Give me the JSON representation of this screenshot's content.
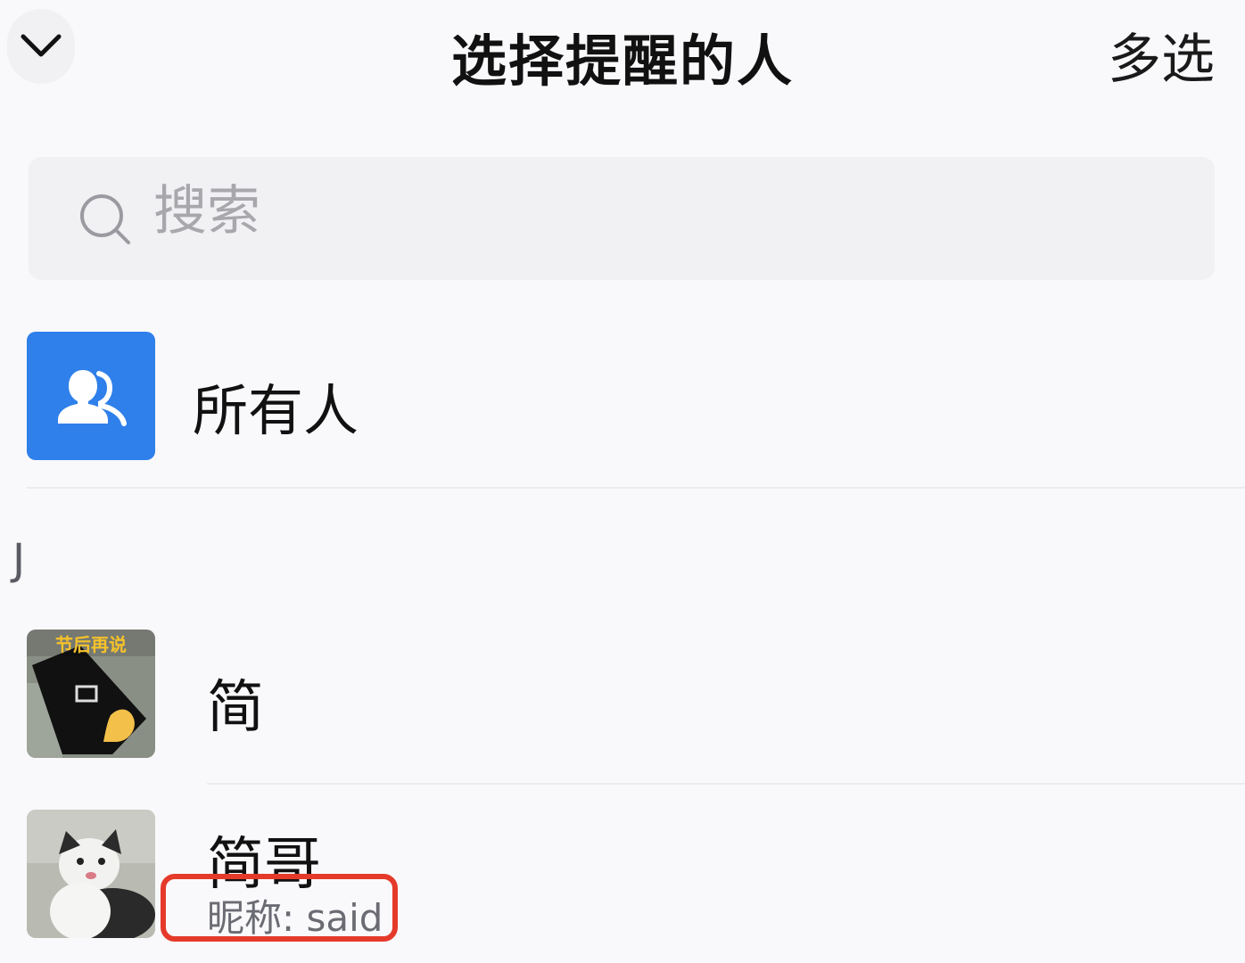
{
  "header": {
    "back_icon": "chevron-down-icon",
    "title": "选择提醒的人",
    "multi_select_label": "多选"
  },
  "search": {
    "icon": "search-icon",
    "placeholder": "搜索"
  },
  "everyone": {
    "icon": "group-user-icon",
    "label": "所有人",
    "accent": "#2f80ea"
  },
  "sections": [
    {
      "letter": "J",
      "contacts": [
        {
          "name": "简",
          "avatar_text": "节后再说"
        },
        {
          "name": "简哥",
          "nickname": "昵称: said"
        }
      ]
    }
  ],
  "highlight_color": "#e53a2a"
}
